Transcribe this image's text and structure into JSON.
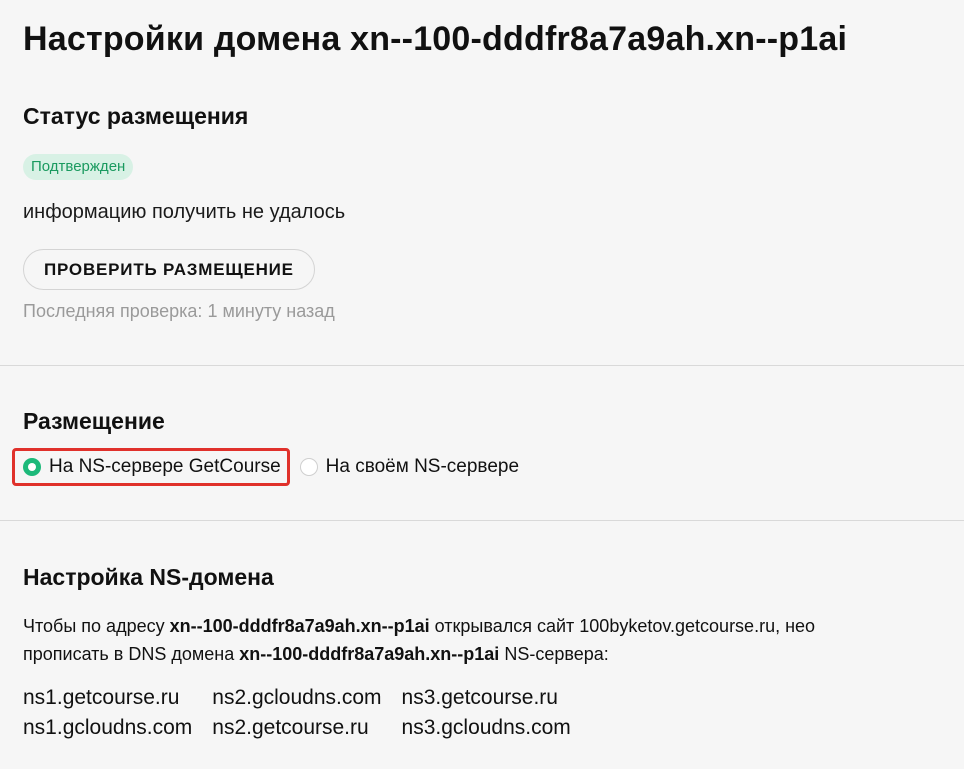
{
  "page_title": "Настройки домена xn--100-dddfr8a7a9ah.xn--p1ai",
  "hosting_status": {
    "heading": "Статус размещения",
    "badge": "Подтвержден",
    "info": "информацию получить не удалось",
    "check_button": "ПРОВЕРИТЬ РАЗМЕЩЕНИЕ",
    "last_check": "Последняя проверка: 1 минуту назад"
  },
  "placement": {
    "heading": "Размещение",
    "options": [
      {
        "label": "На NS-сервере GetCourse",
        "selected": true
      },
      {
        "label": "На своём NS-сервере",
        "selected": false
      }
    ]
  },
  "ns_setup": {
    "heading": "Настройка NS-домена",
    "line1_prefix": "Чтобы по адресу ",
    "line1_domain": "xn--100-dddfr8a7a9ah.xn--p1ai",
    "line1_suffix": " открывался сайт 100byketov.getcourse.ru, нео",
    "line2_prefix": "прописать в DNS домена ",
    "line2_domain": "xn--100-dddfr8a7a9ah.xn--p1ai",
    "line2_suffix": " NS-сервера:",
    "servers": [
      "ns1.getcourse.ru",
      "ns2.gcloudns.com",
      "ns3.getcourse.ru",
      "ns1.gcloudns.com",
      "ns2.getcourse.ru",
      "ns3.gcloudns.com"
    ]
  },
  "colors": {
    "badge_bg": "#d8f1e5",
    "badge_text": "#1a9a5f",
    "radio_selected": "#1db97a",
    "highlight_border": "#e0312b"
  }
}
